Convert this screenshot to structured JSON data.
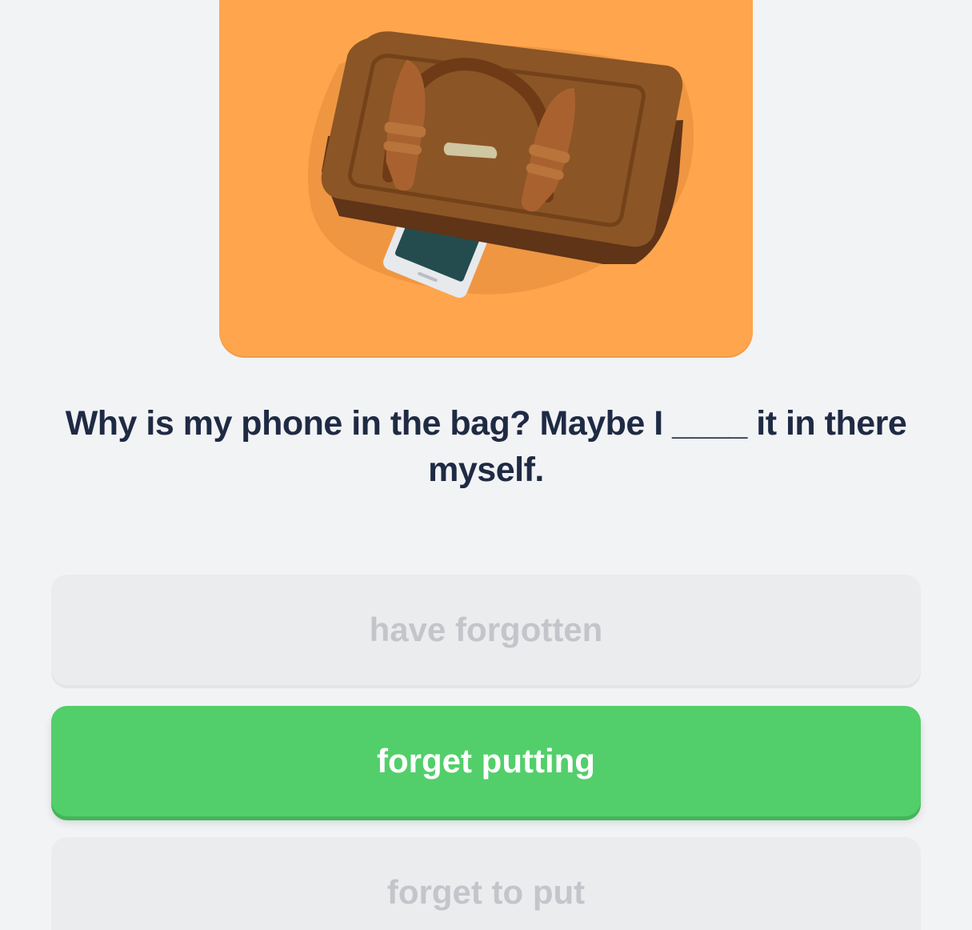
{
  "colors": {
    "background": "#f2f3f5",
    "illustration_bg": "#ffa54d",
    "question_text": "#1f2a44",
    "selected_option": "#52cf6a",
    "disabled_option_bg": "#ebecee",
    "disabled_option_text": "#c3c5ca"
  },
  "illustration": {
    "icon": "bag-with-phone-icon"
  },
  "question": {
    "text_line": "Why is my phone in the bag? Maybe I ____ it in there myself."
  },
  "options": [
    {
      "label": "have forgotten",
      "state": "disabled"
    },
    {
      "label": "forget putting",
      "state": "selected"
    },
    {
      "label": "forget to put",
      "state": "disabled"
    }
  ]
}
